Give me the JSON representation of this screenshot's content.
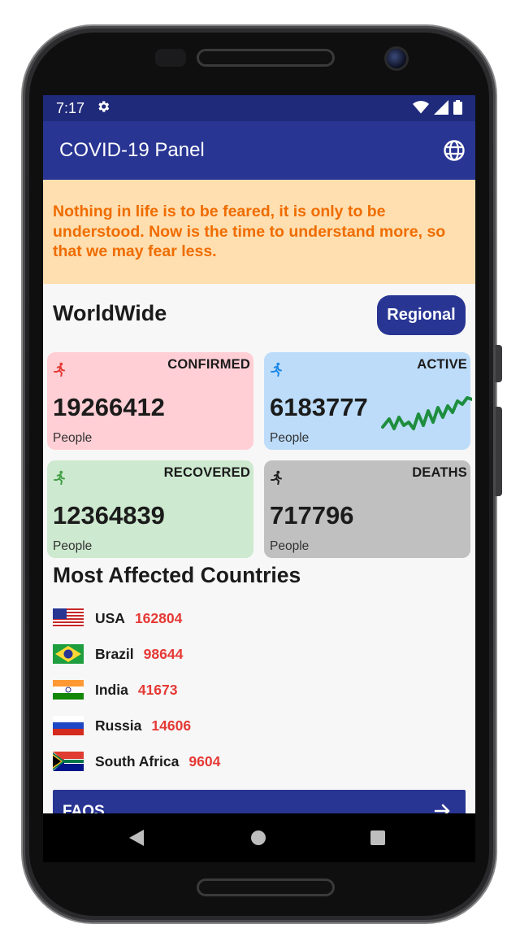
{
  "status_bar": {
    "time": "7:17"
  },
  "app_bar": {
    "title": "COVID-19 Panel"
  },
  "quote": "Nothing in life is to be feared, it is only to be understood. Now is the time to understand more, so that we may fear less.",
  "worldwide": {
    "title": "WorldWide",
    "regional_label": "Regional",
    "cards": {
      "confirmed": {
        "label": "CONFIRMED",
        "value": "19266412",
        "unit": "People",
        "color": "#ffcfd5"
      },
      "active": {
        "label": "ACTIVE",
        "value": "6183777",
        "unit": "People",
        "color": "#bcdcfa"
      },
      "recovered": {
        "label": "RECOVERED",
        "value": "12364839",
        "unit": "People",
        "color": "#cde9cf"
      },
      "deaths": {
        "label": "DEATHS",
        "value": "717796",
        "unit": "People",
        "color": "#c0c0c0"
      }
    }
  },
  "most_affected": {
    "title": "Most Affected Countries",
    "countries": [
      {
        "name": "USA",
        "value": "162804",
        "flag": "us-flag"
      },
      {
        "name": "Brazil",
        "value": "98644",
        "flag": "brazil-flag"
      },
      {
        "name": "India",
        "value": "41673",
        "flag": "india-flag"
      },
      {
        "name": "Russia",
        "value": "14606",
        "flag": "russia-flag"
      },
      {
        "name": "South Africa",
        "value": "9604",
        "flag": "south-africa-flag"
      }
    ]
  },
  "faqs": {
    "label": "FAQS"
  },
  "icons": {
    "settings": "gear-icon",
    "globe": "globe-icon",
    "runner": "running-person-icon",
    "arrow": "arrow-right-icon"
  },
  "colors": {
    "primary": "#283593",
    "status_bar": "#1f2a7a",
    "quote_bg": "#ffdfb0",
    "quote_text": "#ef6c00",
    "country_value": "#e53935",
    "sparkline": "#1e8e3e"
  }
}
